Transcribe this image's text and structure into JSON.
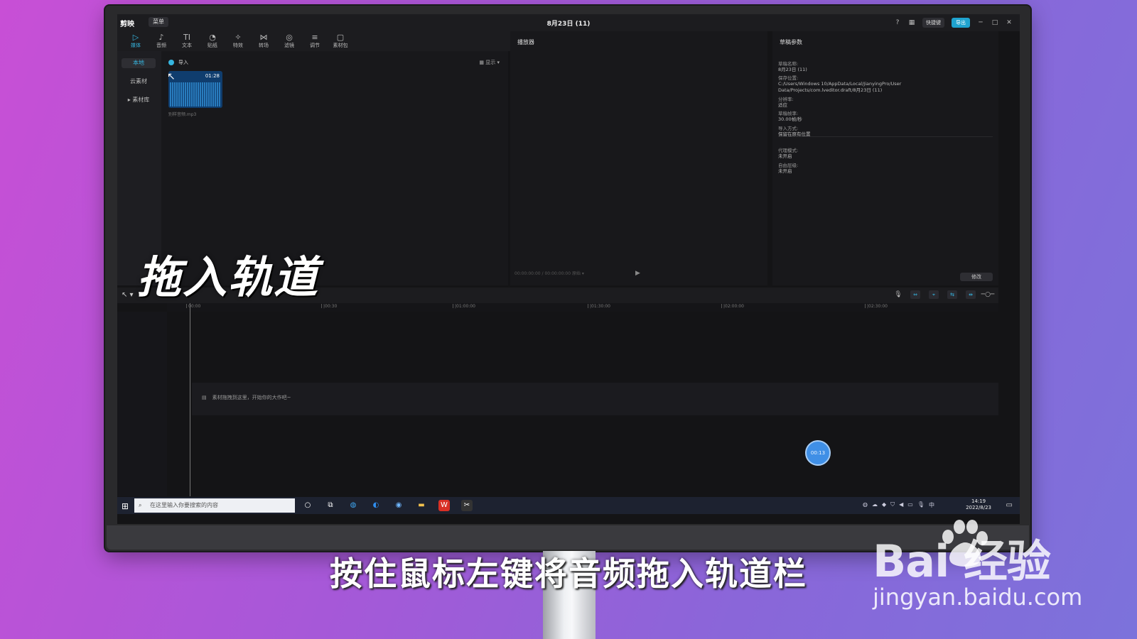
{
  "app": {
    "logo": "剪映",
    "menu_label": "菜单",
    "window_title": "8月23日 (11)",
    "shortcut_label": "快捷键",
    "export_label": "导出"
  },
  "toolbar": {
    "tools": [
      {
        "label": "媒体",
        "glyph": "▷"
      },
      {
        "label": "音频",
        "glyph": "♪"
      },
      {
        "label": "文本",
        "glyph": "TI"
      },
      {
        "label": "贴纸",
        "glyph": "◔"
      },
      {
        "label": "特效",
        "glyph": "✧"
      },
      {
        "label": "转场",
        "glyph": "⋈"
      },
      {
        "label": "滤镜",
        "glyph": "◎"
      },
      {
        "label": "调节",
        "glyph": "≡"
      },
      {
        "label": "素材包",
        "glyph": "▢"
      }
    ]
  },
  "media": {
    "nav": [
      "本地",
      "云素材",
      "素材库"
    ],
    "import_label": "导入",
    "sort_label": "▦ 显示 ▾",
    "card_duration": "01:28",
    "card_name": "别样音频.mp3"
  },
  "player": {
    "title": "播放器",
    "time_current": "00:00:00:00",
    "time_total": "00:00:00:00",
    "ratio_label": "原始 ▾"
  },
  "props": {
    "title": "草稿参数",
    "rows": [
      {
        "k": "草稿名称:",
        "v": "8月23日 (11)"
      },
      {
        "k": "保存位置:",
        "v": "C:/Users/Windows 10/AppData/Local/JianyingPro/User Data/Projects/com.lveditor.draft/8月23日 (11)"
      },
      {
        "k": "分辨率:",
        "v": "适应"
      },
      {
        "k": "草稿帧率:",
        "v": "30.00帧/秒"
      },
      {
        "k": "导入方式:",
        "v": "保留在原有位置"
      },
      {
        "k": "代理模式:",
        "v": "未开启"
      },
      {
        "k": "自由层级:",
        "v": "未开启"
      }
    ],
    "modify_label": "修改"
  },
  "timeline": {
    "ticks": [
      "00:00",
      "|00:30",
      "|01:00:00",
      "|01:30:00",
      "|02:00:00",
      "|02:30:00"
    ],
    "drop_text": "素材拖拽到这里，开始你的大作吧~",
    "time_badge": "00:13"
  },
  "taskbar": {
    "search_placeholder": "在这里输入你要搜索的内容",
    "time": "14:19",
    "date": "2022/8/23",
    "ime": "中"
  },
  "overlay": {
    "big_caption": "拖入轨道",
    "subtitle": "按住鼠标左键将音频拖入轨道栏",
    "wm_brand": "Bai  经验",
    "wm_url": "jingyan.baidu.com"
  }
}
